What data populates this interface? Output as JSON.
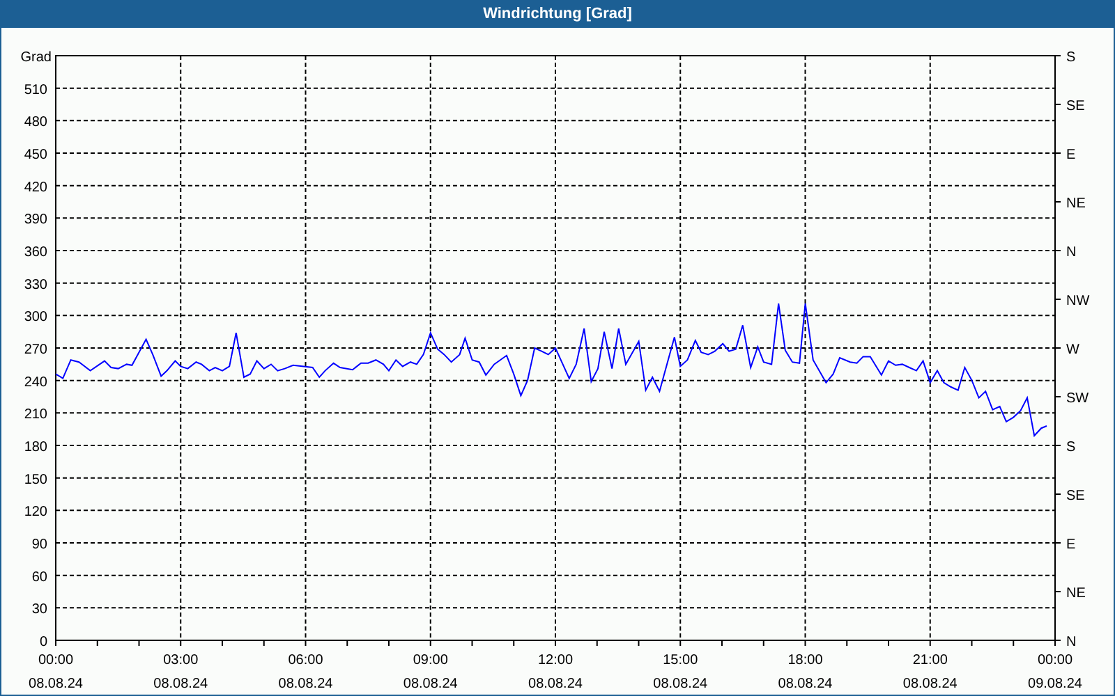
{
  "window": {
    "title": "Windrichtung [Grad]"
  },
  "chart_data": {
    "type": "line",
    "grid": true,
    "ylabel": "Grad",
    "xlim": [
      0,
      24
    ],
    "ylim": [
      0,
      540
    ],
    "xticks": [
      {
        "value": 0,
        "label": "00:00"
      },
      {
        "value": 3,
        "label": "03:00"
      },
      {
        "value": 6,
        "label": "06:00"
      },
      {
        "value": 9,
        "label": "09:00"
      },
      {
        "value": 12,
        "label": "12:00"
      },
      {
        "value": 15,
        "label": "15:00"
      },
      {
        "value": 18,
        "label": "18:00"
      },
      {
        "value": 21,
        "label": "21:00"
      },
      {
        "value": 24,
        "label": "00:00"
      }
    ],
    "yticks": [
      0,
      30,
      60,
      90,
      120,
      150,
      180,
      210,
      240,
      270,
      300,
      330,
      360,
      390,
      420,
      450,
      480,
      510
    ],
    "x": [
      0,
      0.17,
      0.36,
      0.56,
      0.83,
      1.17,
      1.33,
      1.5,
      1.7,
      1.83,
      2.17,
      2.33,
      2.53,
      2.67,
      2.87,
      3,
      3.17,
      3.37,
      3.5,
      3.69,
      3.83,
      4,
      4.17,
      4.33,
      4.52,
      4.67,
      4.83,
      5,
      5.17,
      5.33,
      5.5,
      5.7,
      6.17,
      6.33,
      6.47,
      6.67,
      6.83,
      7.13,
      7.33,
      7.5,
      7.69,
      7.87,
      8,
      8.17,
      8.33,
      8.52,
      8.67,
      8.83,
      9,
      9.17,
      9.33,
      9.5,
      9.7,
      9.83,
      10,
      10.17,
      10.33,
      10.53,
      10.83,
      11,
      11.17,
      11.33,
      11.5,
      11.67,
      11.83,
      12,
      12.33,
      12.5,
      12.69,
      12.86,
      13.02,
      13.17,
      13.36,
      13.52,
      13.69,
      14,
      14.17,
      14.33,
      14.5,
      14.86,
      15,
      15.17,
      15.36,
      15.5,
      15.67,
      15.83,
      16.02,
      16.17,
      16.33,
      16.5,
      16.69,
      16.86,
      17,
      17.19,
      17.36,
      17.52,
      17.69,
      17.86,
      18,
      18.19,
      18.5,
      18.67,
      18.83,
      19.08,
      19.24,
      19.39,
      19.56,
      19.83,
      20,
      20.17,
      20.33,
      20.5,
      20.67,
      20.83,
      21,
      21.17,
      21.33,
      21.5,
      21.67,
      21.83,
      22,
      22.17,
      22.33,
      22.5,
      22.67,
      22.83,
      23,
      23.17,
      23.33,
      23.5,
      23.67,
      23.8
    ],
    "series": [
      {
        "color": "#0000ff",
        "values": [
          246,
          242,
          259,
          257,
          249,
          258,
          252,
          251,
          255,
          254,
          278,
          264,
          244,
          249,
          258,
          253,
          251,
          257,
          255,
          249,
          252,
          249,
          253,
          284,
          243,
          246,
          258,
          251,
          255,
          249,
          251,
          254,
          252,
          243,
          249,
          256,
          252,
          250,
          256,
          256,
          259,
          255,
          249,
          259,
          253,
          257,
          255,
          264,
          284,
          269,
          264,
          257,
          264,
          279,
          259,
          257,
          245,
          255,
          263,
          246,
          226,
          240,
          270,
          267,
          264,
          270,
          242,
          255,
          288,
          239,
          251,
          285,
          251,
          288,
          255,
          276,
          231,
          243,
          230,
          280,
          253,
          259,
          277,
          266,
          264,
          267,
          274,
          267,
          269,
          291,
          252,
          271,
          257,
          255,
          311,
          268,
          257,
          256,
          311,
          259,
          238,
          246,
          261,
          257,
          256,
          262,
          262,
          245,
          258,
          254,
          255,
          252,
          249,
          258,
          238,
          249,
          238,
          234,
          231,
          252,
          240,
          224,
          230,
          213,
          216,
          202,
          206,
          212,
          224,
          189,
          196,
          198
        ]
      }
    ]
  },
  "x_dates": [
    "08.08.24",
    "08.08.24",
    "08.08.24",
    "08.08.24",
    "08.08.24",
    "08.08.24",
    "08.08.24",
    "08.08.24",
    "09.08.24"
  ],
  "compass_labels": [
    "S",
    "SE",
    "E",
    "NE",
    "N",
    "NW",
    "W",
    "SW",
    "S",
    "SE",
    "E",
    "NE",
    "N"
  ]
}
